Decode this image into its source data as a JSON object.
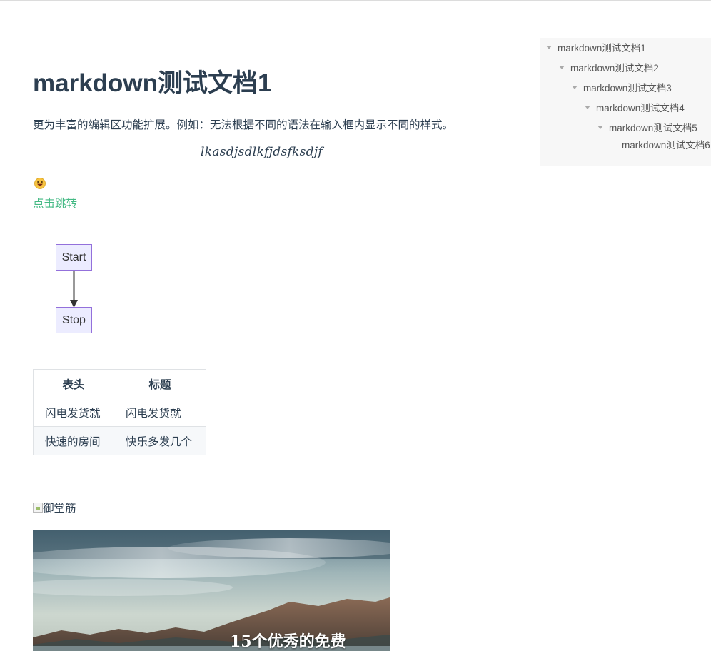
{
  "article": {
    "title": "markdown测试文档1",
    "intro": "更为丰富的编辑区功能扩展。例如：无法根据不同的语法在输入框内显示不同的样式。",
    "math": "lkasdjsdlkfjdsfksdjf",
    "link_label": "点击跳转",
    "link_color": "#42b983"
  },
  "flowchart": {
    "nodes": [
      "Start",
      "Stop"
    ],
    "node_fill": "#ececff",
    "node_border": "#9370db"
  },
  "table": {
    "headers": [
      "表头",
      "标题"
    ],
    "rows": [
      [
        "闪电发货就",
        "闪电发货就"
      ],
      [
        "快速的房间",
        "快乐多发几个"
      ]
    ]
  },
  "images": {
    "broken_alt": "御堂筋",
    "banner_caption": "15个优秀的免费"
  },
  "toc": {
    "items": [
      {
        "label": "markdown测试文档1",
        "collapsible": true
      },
      {
        "label": "markdown测试文档2",
        "collapsible": true
      },
      {
        "label": "markdown测试文档3",
        "collapsible": true
      },
      {
        "label": "markdown测试文档4",
        "collapsible": true
      },
      {
        "label": "markdown测试文档5",
        "collapsible": true
      },
      {
        "label": "markdown测试文档6",
        "collapsible": false
      }
    ]
  }
}
